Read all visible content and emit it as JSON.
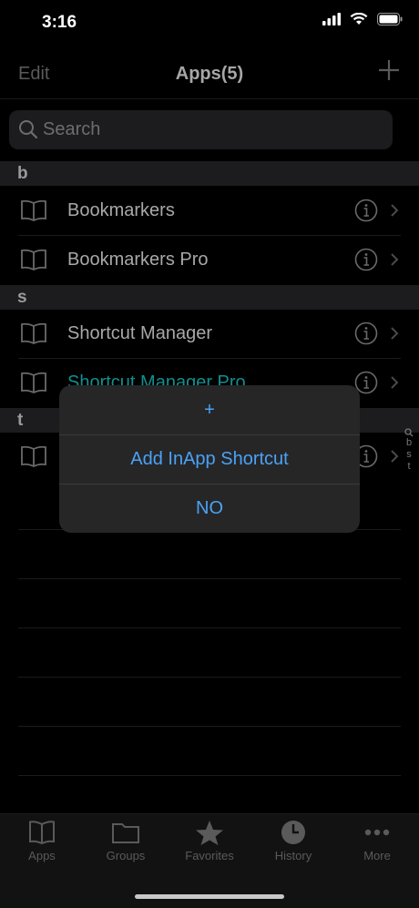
{
  "status": {
    "time": "3:16"
  },
  "nav": {
    "edit_label": "Edit",
    "title": "Apps(5)"
  },
  "search": {
    "placeholder": "Search"
  },
  "sections": [
    {
      "letter": "b",
      "rows": [
        "Bookmarkers",
        "Bookmarkers Pro"
      ]
    },
    {
      "letter": "s",
      "rows": [
        "Shortcut Manager",
        "Shortcut Manager Pro"
      ]
    },
    {
      "letter": "t",
      "rows": [
        ""
      ]
    }
  ],
  "index": [
    "b",
    "s",
    "t"
  ],
  "dialog": {
    "buttons": [
      "+",
      "Add InApp Shortcut",
      "NO"
    ]
  },
  "tabbar": {
    "tabs": [
      {
        "label": "Apps",
        "icon": "book-icon"
      },
      {
        "label": "Groups",
        "icon": "folder-icon"
      },
      {
        "label": "Favorites",
        "icon": "star-icon"
      },
      {
        "label": "History",
        "icon": "clock-icon"
      },
      {
        "label": "More",
        "icon": "more-icon"
      }
    ]
  },
  "colors": {
    "accent": "#4aa2f7",
    "highlight_text": "#128f8f"
  }
}
